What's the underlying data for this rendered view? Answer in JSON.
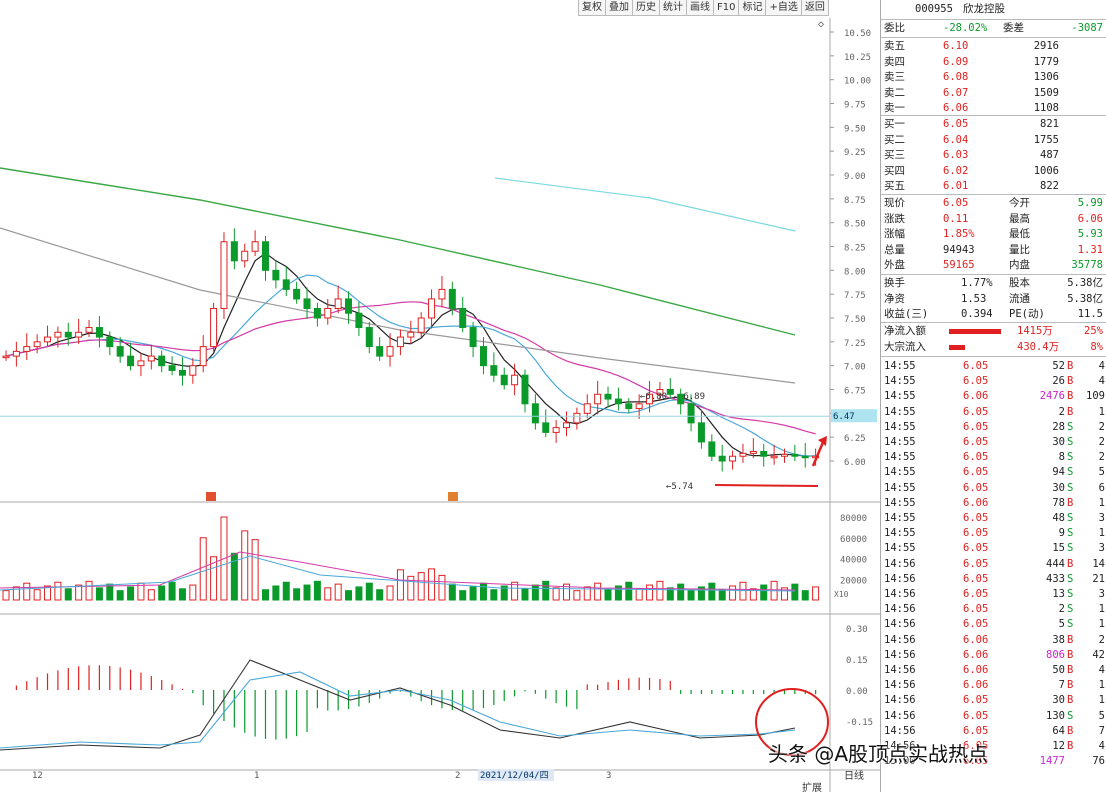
{
  "toolbar": [
    "复权",
    "叠加",
    "历史",
    "统计",
    "画线",
    "F10",
    "标记",
    "+自选",
    "返回"
  ],
  "stock": {
    "code": "000955",
    "name": "欣龙控股"
  },
  "weibi": {
    "label": "委比",
    "value": "-28.02%",
    "label2": "委差",
    "value2": "-3087"
  },
  "sell": [
    {
      "label": "卖五",
      "price": "6.10",
      "vol": "2916"
    },
    {
      "label": "卖四",
      "price": "6.09",
      "vol": "1779"
    },
    {
      "label": "卖三",
      "price": "6.08",
      "vol": "1306"
    },
    {
      "label": "卖二",
      "price": "6.07",
      "vol": "1509"
    },
    {
      "label": "卖一",
      "price": "6.06",
      "vol": "1108"
    }
  ],
  "buy": [
    {
      "label": "买一",
      "price": "6.05",
      "vol": "821"
    },
    {
      "label": "买二",
      "price": "6.04",
      "vol": "1755"
    },
    {
      "label": "买三",
      "price": "6.03",
      "vol": "487"
    },
    {
      "label": "买四",
      "price": "6.02",
      "vol": "1006"
    },
    {
      "label": "买五",
      "price": "6.01",
      "vol": "822"
    }
  ],
  "quote": [
    {
      "l1": "现价",
      "v1": "6.05",
      "c1": "red",
      "l2": "今开",
      "v2": "5.99",
      "c2": "green"
    },
    {
      "l1": "涨跌",
      "v1": "0.11",
      "c1": "red",
      "l2": "最高",
      "v2": "6.06",
      "c2": "red"
    },
    {
      "l1": "涨幅",
      "v1": "1.85%",
      "c1": "red",
      "l2": "最低",
      "v2": "5.93",
      "c2": "green"
    },
    {
      "l1": "总量",
      "v1": "94943",
      "c1": "",
      "l2": "量比",
      "v2": "1.31",
      "c2": "red"
    },
    {
      "l1": "外盘",
      "v1": "59165",
      "c1": "red",
      "l2": "内盘",
      "v2": "35778",
      "c2": "green"
    }
  ],
  "fund": [
    {
      "l1": "换手",
      "v1": "1.77%",
      "l2": "股本",
      "v2": "5.38亿"
    },
    {
      "l1": "净资",
      "v1": "1.53",
      "l2": "流通",
      "v2": "5.38亿"
    },
    {
      "l1": "收益(三)",
      "v1": "0.394",
      "l2": "PE(动)",
      "v2": "11.5"
    }
  ],
  "flow": [
    {
      "label": "净流入额",
      "value": "1415万",
      "pct": "25%"
    },
    {
      "label": "大宗流入",
      "value": "430.4万",
      "pct": "8%"
    }
  ],
  "ticks": [
    {
      "t": "14:55",
      "p": "6.05",
      "v": "52",
      "d": "B",
      "n": "4"
    },
    {
      "t": "14:55",
      "p": "6.05",
      "v": "26",
      "d": "B",
      "n": "4"
    },
    {
      "t": "14:55",
      "p": "6.06",
      "v": "2476",
      "d": "B",
      "n": "109",
      "mag": true
    },
    {
      "t": "14:55",
      "p": "6.05",
      "v": "2",
      "d": "B",
      "n": "1"
    },
    {
      "t": "14:55",
      "p": "6.05",
      "v": "28",
      "d": "S",
      "n": "2"
    },
    {
      "t": "14:55",
      "p": "6.05",
      "v": "30",
      "d": "S",
      "n": "2"
    },
    {
      "t": "14:55",
      "p": "6.05",
      "v": "8",
      "d": "S",
      "n": "2"
    },
    {
      "t": "14:55",
      "p": "6.05",
      "v": "94",
      "d": "S",
      "n": "5"
    },
    {
      "t": "14:55",
      "p": "6.05",
      "v": "30",
      "d": "S",
      "n": "6"
    },
    {
      "t": "14:55",
      "p": "6.06",
      "v": "78",
      "d": "B",
      "n": "1"
    },
    {
      "t": "14:55",
      "p": "6.05",
      "v": "48",
      "d": "S",
      "n": "3"
    },
    {
      "t": "14:55",
      "p": "6.05",
      "v": "9",
      "d": "S",
      "n": "1"
    },
    {
      "t": "14:55",
      "p": "6.05",
      "v": "15",
      "d": "S",
      "n": "3"
    },
    {
      "t": "14:56",
      "p": "6.05",
      "v": "444",
      "d": "B",
      "n": "14"
    },
    {
      "t": "14:56",
      "p": "6.05",
      "v": "433",
      "d": "S",
      "n": "21"
    },
    {
      "t": "14:56",
      "p": "6.05",
      "v": "13",
      "d": "S",
      "n": "3"
    },
    {
      "t": "14:56",
      "p": "6.05",
      "v": "2",
      "d": "S",
      "n": "1"
    },
    {
      "t": "14:56",
      "p": "6.05",
      "v": "5",
      "d": "S",
      "n": "1"
    },
    {
      "t": "14:56",
      "p": "6.06",
      "v": "38",
      "d": "B",
      "n": "2"
    },
    {
      "t": "14:56",
      "p": "6.06",
      "v": "806",
      "d": "B",
      "n": "42",
      "mag": true
    },
    {
      "t": "14:56",
      "p": "6.06",
      "v": "50",
      "d": "B",
      "n": "4"
    },
    {
      "t": "14:56",
      "p": "6.06",
      "v": "7",
      "d": "B",
      "n": "1"
    },
    {
      "t": "14:56",
      "p": "6.05",
      "v": "30",
      "d": "B",
      "n": "1"
    },
    {
      "t": "14:56",
      "p": "6.05",
      "v": "130",
      "d": "S",
      "n": "5"
    },
    {
      "t": "14:56",
      "p": "6.05",
      "v": "64",
      "d": "B",
      "n": "7"
    },
    {
      "t": "14:56",
      "p": "6.05",
      "v": "12",
      "d": "B",
      "n": "4"
    },
    {
      "t": "15:00",
      "p": "6.05",
      "v": "1477",
      "d": "",
      "n": "76",
      "mag": true
    }
  ],
  "price_axis": [
    "10.50",
    "10.25",
    "10.00",
    "9.75",
    "9.50",
    "9.25",
    "9.00",
    "8.75",
    "8.50",
    "8.25",
    "8.00",
    "7.75",
    "7.50",
    "7.25",
    "7.00",
    "6.75",
    "6.50",
    "6.25",
    "6.00"
  ],
  "current_price_tag": "6.47",
  "annotations": {
    "high": "6.80 - 6.89",
    "low": "5.74",
    "date": "2021/12/04/四"
  },
  "vol_axis": [
    "80000",
    "60000",
    "40000",
    "20000"
  ],
  "vol_unit": "X10",
  "macd_axis": [
    "0.30",
    "0.15",
    "0.00",
    "-0.15"
  ],
  "date_labels": [
    "12",
    "1",
    "2",
    "3"
  ],
  "bottom_btns": [
    "日线",
    "扩展"
  ],
  "watermark": "头条 @A股顶点实战热点",
  "colors": {
    "up": "#e02020",
    "down": "#0a9a2a",
    "ma5": "#222222",
    "ma10": "#4aa8d8",
    "ma20": "#d63aa8",
    "ma60": "#999999",
    "ma120": "#3aa844",
    "ma250": "#7ad8e0"
  }
}
